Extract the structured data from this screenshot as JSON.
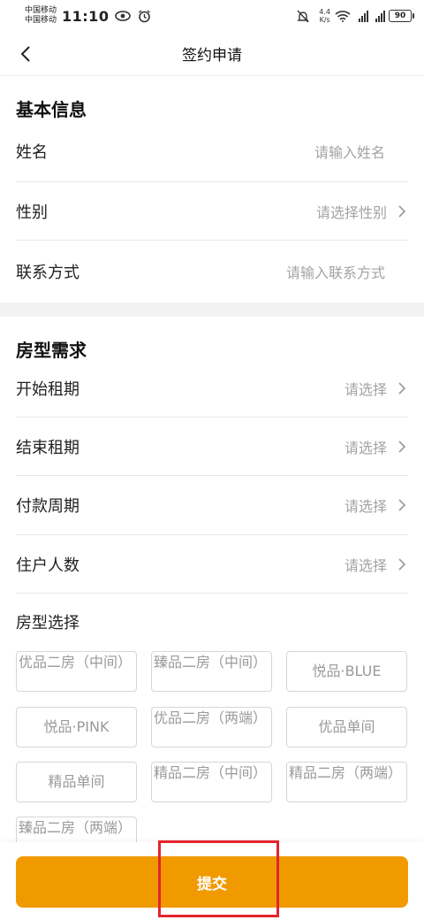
{
  "status_bar": {
    "carrier1": "中国移动",
    "carrier2": "中国移动",
    "time": "11:10",
    "net_speed_value": "4.4",
    "net_speed_unit": "K/s",
    "battery": "90"
  },
  "nav": {
    "title": "签约申请"
  },
  "basic_info": {
    "title": "基本信息",
    "name_label": "姓名",
    "name_placeholder": "请输入姓名",
    "gender_label": "性别",
    "gender_placeholder": "请选择性别",
    "contact_label": "联系方式",
    "contact_placeholder": "请输入联系方式"
  },
  "room_needs": {
    "title": "房型需求",
    "rows": [
      {
        "label": "开始租期",
        "value": "请选择"
      },
      {
        "label": "结束租期",
        "value": "请选择"
      },
      {
        "label": "付款周期",
        "value": "请选择"
      },
      {
        "label": "住户人数",
        "value": "请选择"
      }
    ],
    "room_select_label": "房型选择",
    "room_options": [
      "优品二房（中间）",
      "臻品二房（中间）",
      "悦品·BLUE",
      "悦品·PINK",
      "优品二房（两端）",
      "优品单间",
      "精品单间",
      "精品二房（中间）",
      "精品二房（两端）",
      "臻品二房（两端）"
    ]
  },
  "footer": {
    "submit_label": "提交"
  },
  "colors": {
    "accent": "#f19a00",
    "highlight": "#e3242f"
  }
}
